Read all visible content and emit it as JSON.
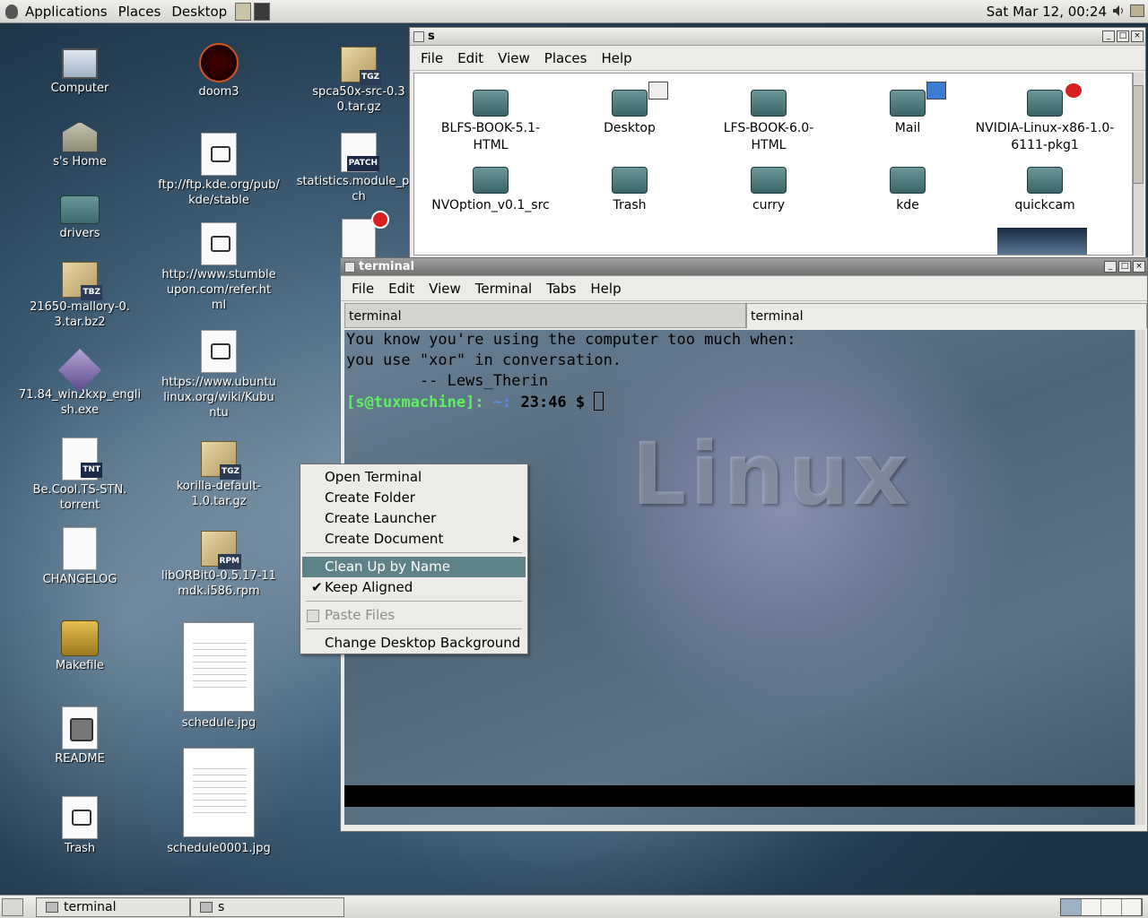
{
  "top_panel": {
    "menus": [
      "Applications",
      "Places",
      "Desktop"
    ],
    "clock": "Sat Mar 12, 00:24"
  },
  "desktop_icons": {
    "computer": "Computer",
    "home": "s's Home",
    "drivers": "drivers",
    "mallory": "21650-mallory-0.3.tar.bz2",
    "win2kxp": "71.84_win2kxp_english.exe",
    "torrent": "Be.Cool.TS-STN.torrent",
    "changelog": "CHANGELOG",
    "makefile": "Makefile",
    "readme": "README",
    "trash": "Trash",
    "doom3": "doom3",
    "kde_link": "ftp://ftp.kde.org/pub/kde/stable",
    "stumble": "http://www.stumbleupon.com/refer.html",
    "ubuntu": "https://www.ubuntulinux.org/wiki/Kubuntu",
    "korilla": "korilla-default-1.0.tar.gz",
    "liborbit": "libORBit0-0.5.17-11mdk.i586.rpm",
    "schedule": "schedule.jpg",
    "schedule0001": "schedule0001.jpg",
    "spca": "spca50x-src-0.30.tar.gz",
    "statistics": "statistics.module_patch",
    "badges": {
      "tgz": "TGZ",
      "tbz": "TBZ",
      "tnt": "TNT",
      "rpm": "RPM",
      "patch": "PATCH"
    }
  },
  "file_manager": {
    "title": "s",
    "menus": [
      "File",
      "Edit",
      "View",
      "Places",
      "Help"
    ],
    "items": [
      "BLFS-BOOK-5.1-HTML",
      "Desktop",
      "LFS-BOOK-6.0-HTML",
      "Mail",
      "NVIDIA-Linux-x86-1.0-6111-pkg1",
      "NVOption_v0.1_src",
      "Trash",
      "curry",
      "kde",
      "quickcam"
    ]
  },
  "terminal": {
    "title": "terminal",
    "menus": [
      "File",
      "Edit",
      "View",
      "Terminal",
      "Tabs",
      "Help"
    ],
    "tabs": [
      "terminal",
      "terminal"
    ],
    "lines": [
      "You know you're using the computer too much when:",
      "you use \"xor\" in conversation.",
      "        -- Lews_Therin"
    ],
    "prompt": {
      "user_host": "[s@tuxmachine]:",
      "path": " ~:",
      "time": " 23:46 $ "
    },
    "logo_text": "Linux"
  },
  "context_menu": {
    "items": [
      {
        "label": "Open Terminal"
      },
      {
        "label": "Create Folder"
      },
      {
        "label": "Create Launcher"
      },
      {
        "label": "Create Document"
      },
      {
        "label": "Clean Up by Name"
      },
      {
        "label": "Keep Aligned"
      },
      {
        "label": "Paste Files"
      },
      {
        "label": "Change Desktop Background"
      }
    ],
    "highlighted": "Clean Up by Name",
    "checked": "Keep Aligned",
    "disabled": "Paste Files"
  },
  "bottom_panel": {
    "tasks": [
      "terminal",
      "s"
    ],
    "workspaces": 4,
    "active_workspace": 1
  },
  "colors": {
    "menu_highlight": "#5d8389",
    "prompt_green": "#5ef05e",
    "prompt_blue": "#5b8ee6"
  },
  "icons": {
    "volume": "speaker-icon",
    "foot": "gnome-foot-icon"
  }
}
